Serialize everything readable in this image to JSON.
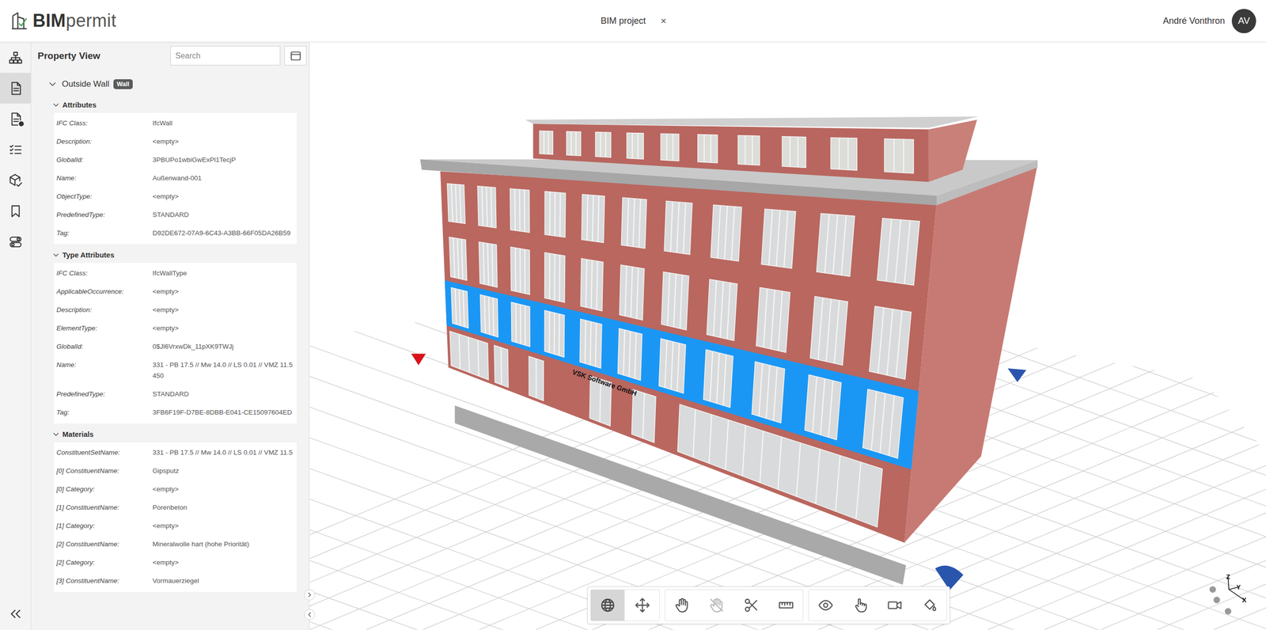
{
  "header": {
    "logo": {
      "strong": "BIM",
      "light": "permit"
    },
    "project": {
      "title": "BIM project",
      "close": "×"
    },
    "user": {
      "name": "André Vonthron",
      "initials": "AV"
    }
  },
  "rail": {
    "items": [
      {
        "kind": "tree",
        "selected": false,
        "badge": false
      },
      {
        "kind": "properties",
        "selected": true,
        "badge": false
      },
      {
        "kind": "documents",
        "selected": false,
        "badge": true
      },
      {
        "kind": "checklist",
        "selected": false,
        "badge": false
      },
      {
        "kind": "model-check",
        "selected": false,
        "badge": false
      },
      {
        "kind": "bookmark",
        "selected": false,
        "badge": false
      },
      {
        "kind": "settings",
        "selected": false,
        "badge": false
      }
    ]
  },
  "panel": {
    "title": "Property View",
    "search": {
      "placeholder": "Search"
    },
    "element": {
      "name": "Outside Wall",
      "badge": "Wall",
      "expanded": true
    },
    "sections": [
      {
        "title": "Attributes",
        "expanded": true,
        "rows": [
          {
            "label": "IFC Class:",
            "value": "IfcWall"
          },
          {
            "label": "Description:",
            "value": "<empty>"
          },
          {
            "label": "GlobalId:",
            "value": "3PBUPo1wbiGwExPl1TecjP"
          },
          {
            "label": "Name:",
            "value": "Außenwand-001"
          },
          {
            "label": "ObjectType:",
            "value": "<empty>"
          },
          {
            "label": "PredefinedType:",
            "value": "STANDARD"
          },
          {
            "label": "Tag:",
            "value": "D92DE672-07A9-6C43-A3BB-66F05DA26B59"
          }
        ]
      },
      {
        "title": "Type Attributes",
        "expanded": true,
        "rows": [
          {
            "label": "IFC Class:",
            "value": "IfcWallType"
          },
          {
            "label": "ApplicableOccurrence:",
            "value": "<empty>"
          },
          {
            "label": "Description:",
            "value": "<empty>"
          },
          {
            "label": "ElementType:",
            "value": "<empty>"
          },
          {
            "label": "GlobalId:",
            "value": "0$Jl6VrxwDk_11pXK9TWJj"
          },
          {
            "label": "Name:",
            "value": "331 - PB 17.5 // Mw 14.0 // LS 0.01 // VMZ 11.5 450"
          },
          {
            "label": "PredefinedType:",
            "value": "STANDARD"
          },
          {
            "label": "Tag:",
            "value": "3FB6F19F-D7BE-8DBB-E041-CE15097604ED"
          }
        ]
      },
      {
        "title": "Materials",
        "expanded": true,
        "rows": [
          {
            "label": "ConstituentSetName:",
            "value": "331 - PB 17.5 // Mw 14.0 // LS 0.01 // VMZ 11.5"
          },
          {
            "label": "[0] ConstituentName:",
            "value": "Gipsputz"
          },
          {
            "label": "[0] Category:",
            "value": "<empty>"
          },
          {
            "label": "[1] ConstituentName:",
            "value": "Porenbeton"
          },
          {
            "label": "[1] Category:",
            "value": "<empty>"
          },
          {
            "label": "[2] ConstituentName:",
            "value": "Mineralwolle hart (hohe Priorität)"
          },
          {
            "label": "[2] Category:",
            "value": "<empty>"
          },
          {
            "label": "[3] ConstituentName:",
            "value": "Vormauerziegel"
          }
        ]
      }
    ]
  },
  "viewport": {
    "building_sign": "VSK Software GmbH",
    "selection_highlighted": true,
    "toolbar": {
      "groups": [
        {
          "tools": [
            {
              "kind": "globe",
              "selected": true,
              "disabled": false
            },
            {
              "kind": "move",
              "selected": false,
              "disabled": false
            }
          ]
        },
        {
          "tools": [
            {
              "kind": "hand",
              "selected": false,
              "disabled": false
            },
            {
              "kind": "hand-hide",
              "selected": false,
              "disabled": true
            },
            {
              "kind": "scissors",
              "selected": false,
              "disabled": false
            },
            {
              "kind": "ruler",
              "selected": false,
              "disabled": false
            }
          ]
        },
        {
          "tools": [
            {
              "kind": "eye",
              "selected": false,
              "disabled": false
            },
            {
              "kind": "pointer",
              "selected": false,
              "disabled": false
            },
            {
              "kind": "camera",
              "selected": false,
              "disabled": false
            },
            {
              "kind": "paint",
              "selected": false,
              "disabled": false
            }
          ]
        }
      ]
    },
    "gizmo": {
      "axes": [
        {
          "label": "Z"
        },
        {
          "label": "Y"
        },
        {
          "label": "X"
        }
      ]
    }
  }
}
